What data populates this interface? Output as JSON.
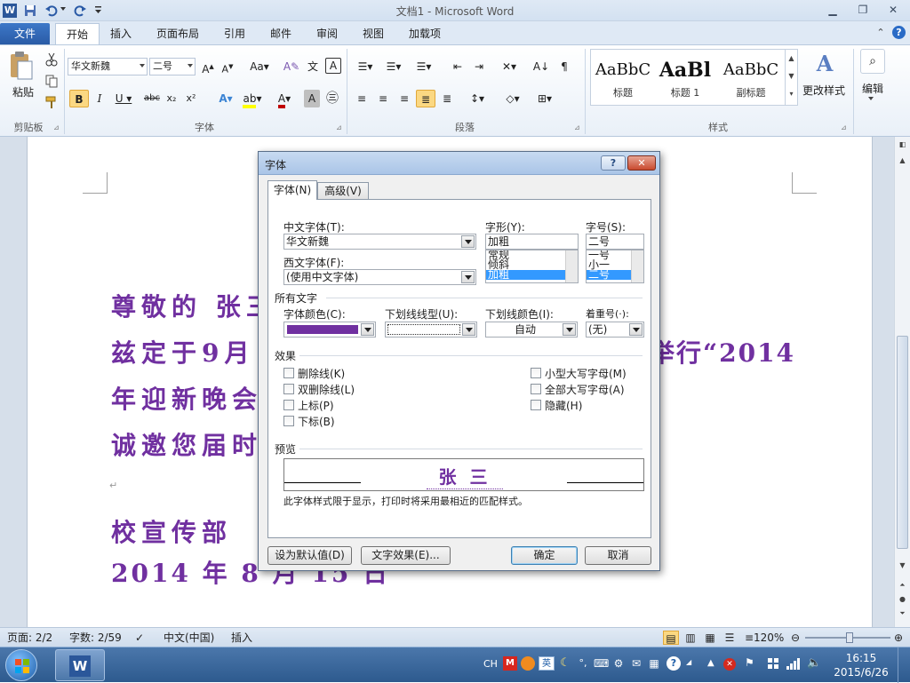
{
  "window": {
    "title": "文档1  -  Microsoft Word"
  },
  "tabs": [
    {
      "id": "file",
      "label": "文件"
    },
    {
      "id": "home",
      "label": "开始"
    },
    {
      "id": "insert",
      "label": "插入"
    },
    {
      "id": "layout",
      "label": "页面布局"
    },
    {
      "id": "references",
      "label": "引用"
    },
    {
      "id": "mailings",
      "label": "邮件"
    },
    {
      "id": "review",
      "label": "审阅"
    },
    {
      "id": "view",
      "label": "视图"
    },
    {
      "id": "addins",
      "label": "加载项"
    }
  ],
  "ribbon": {
    "clipboard": {
      "label": "剪贴板",
      "paste": "粘贴"
    },
    "font": {
      "label": "字体",
      "font_name": "华文新魏",
      "font_size": "二号"
    },
    "paragraph": {
      "label": "段落"
    },
    "styles": {
      "label": "样式",
      "items": [
        {
          "preview": "AaBbC",
          "name": "标题"
        },
        {
          "preview": "AaBl",
          "name": "标题 1"
        },
        {
          "preview": "AaBbC",
          "name": "副标题"
        }
      ],
      "change_styles": "更改样式"
    },
    "editing": {
      "label": "编辑"
    }
  },
  "document": {
    "lines": [
      "尊敬的 张三",
      "兹定于9月",
      "举行“2014",
      "年迎新晚会",
      "诚邀您届时",
      "校宣传部",
      "2014 年 8 月 15 日"
    ],
    "text_color": "#7030a0"
  },
  "dialog": {
    "title": "字体",
    "tabs": [
      {
        "label": "字体(N)",
        "active": true
      },
      {
        "label": "高级(V)",
        "active": false
      }
    ],
    "chinese_font": {
      "label": "中文字体(T):",
      "value": "华文新魏"
    },
    "western_font": {
      "label": "西文字体(F):",
      "value": "(使用中文字体)"
    },
    "font_style": {
      "label": "字形(Y):",
      "value": "加粗",
      "options": [
        "常规",
        "倾斜",
        "加粗"
      ],
      "selected": "加粗"
    },
    "font_size": {
      "label": "字号(S):",
      "value": "二号",
      "options": [
        "一号",
        "小一",
        "二号"
      ],
      "selected": "二号"
    },
    "all_text": {
      "label": "所有文字",
      "font_color": "字体颜色(C):",
      "font_color_value": "#7030a0",
      "underline_type": "下划线线型(U):",
      "underline_color": "下划线颜色(I):",
      "underline_color_value": "自动",
      "emphasis": "着重号(·):",
      "emphasis_value": "(无)"
    },
    "effects": {
      "label": "效果",
      "left": [
        "删除线(K)",
        "双删除线(L)",
        "上标(P)",
        "下标(B)"
      ],
      "right": [
        "小型大写字母(M)",
        "全部大写字母(A)",
        "隐藏(H)"
      ]
    },
    "preview": {
      "label": "预览",
      "sample": "张 三",
      "note": "此字体样式限于显示，打印时将采用最相近的匹配样式。"
    },
    "buttons": {
      "set_default": "设为默认值(D)",
      "text_effects": "文字效果(E)...",
      "ok": "确定",
      "cancel": "取消"
    }
  },
  "status": {
    "page": "页面: 2/2",
    "words": "字数: 2/59",
    "language": "中文(中国)",
    "mode": "插入",
    "zoom": "120%"
  },
  "taskbar": {
    "ime": "CH",
    "time": "16:15",
    "date": "2015/6/26"
  }
}
